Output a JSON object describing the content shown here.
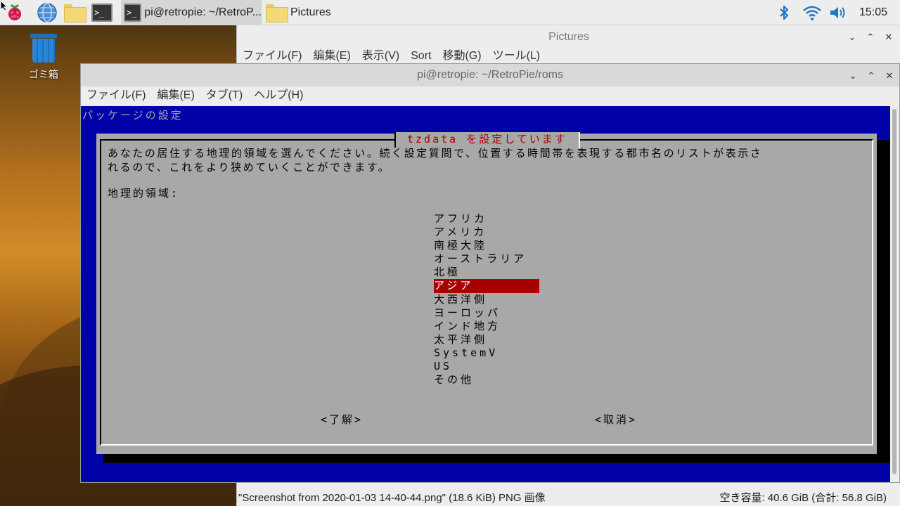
{
  "taskbar": {
    "tasks": [
      {
        "label": "pi@retropie: ~/RetroP..."
      },
      {
        "label": "Pictures"
      }
    ],
    "clock": "15:05"
  },
  "desktop": {
    "trash_label": "ゴミ箱"
  },
  "pictures_window": {
    "title": "Pictures",
    "menu": [
      "ファイル(F)",
      "編集(E)",
      "表示(V)",
      "Sort",
      "移動(G)",
      "ツール(L)"
    ],
    "status_left": "\"Screenshot from 2020-01-03 14-40-44.png\" (18.6 KiB) PNG 画像",
    "status_right": "空き容量: 40.6 GiB (合計: 56.8 GiB)"
  },
  "terminal_window": {
    "title": "pi@retropie: ~/RetroPie/roms",
    "menu": [
      "ファイル(F)",
      "編集(E)",
      "タブ(T)",
      "ヘルプ(H)"
    ],
    "back_title": "パッケージの設定",
    "dialog": {
      "title": "tzdata を設定しています",
      "description_line1": "あなたの居住する地理的領域を選んでください。続く設定質問で、位置する時間帯を表現する都市名のリストが表示さ",
      "description_line2": "れるので、これをより狭めていくことができます。",
      "prompt": "地理的領域:",
      "options": [
        "アフリカ",
        "アメリカ",
        "南極大陸",
        "オーストラリア",
        "北極",
        "アジア",
        "大西洋側",
        "ヨーロッパ",
        "インド地方",
        "太平洋側",
        "SystemV",
        "US",
        "その他"
      ],
      "selected_index": 5,
      "ok_label": "<了解>",
      "cancel_label": "<取消>"
    }
  },
  "colors": {
    "terminal_bg": "#0000a8",
    "dialog_bg": "#a8a8a8",
    "highlight": "#a80000"
  }
}
